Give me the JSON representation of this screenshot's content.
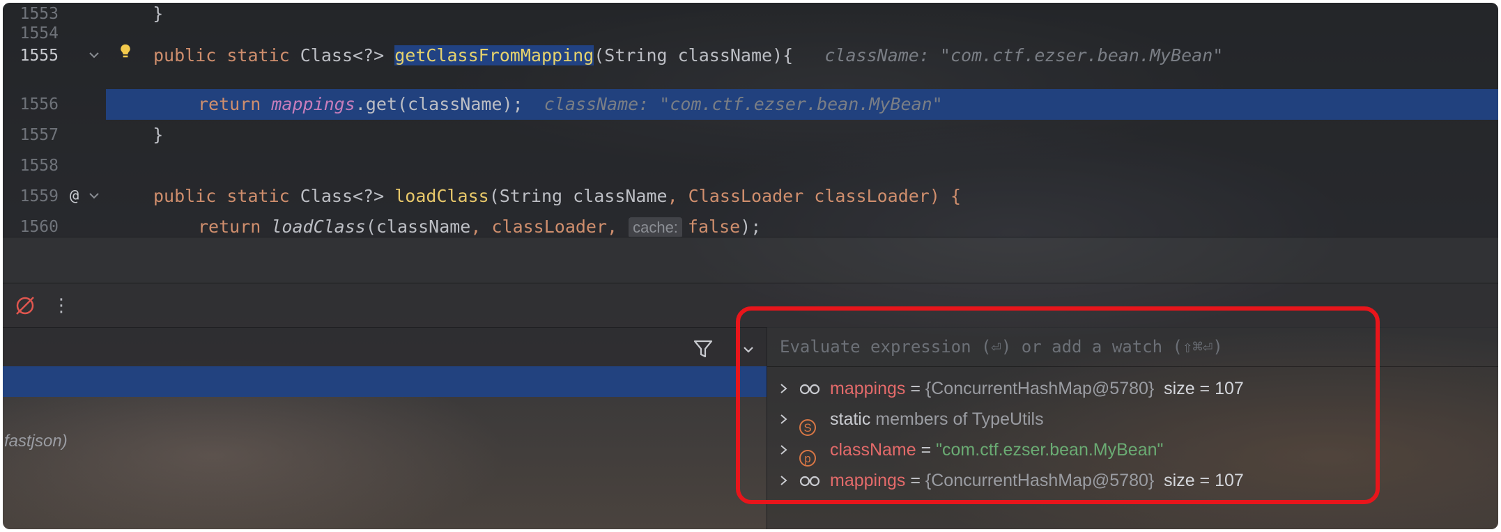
{
  "editor": {
    "lines": [
      {
        "num": "1553",
        "text": "    }"
      },
      {
        "num": "1554",
        "text": ""
      },
      {
        "num": "1555",
        "kw1": "public",
        "kw2": "static",
        "ret": "Class<?>",
        "method": "getClassFromMapping",
        "params": "(String className){",
        "hint": "className: \"com.ctf.ezser.bean.MyBean\""
      },
      {
        "num": "1556",
        "kw": "return",
        "field": "mappings",
        "call": ".get(className);",
        "hint": "className: \"com.ctf.ezser.bean.MyBean\""
      },
      {
        "num": "1557",
        "text": "    }"
      },
      {
        "num": "1558",
        "text": ""
      },
      {
        "num": "1559",
        "kw1": "public",
        "kw2": "static",
        "ret": "Class<?>",
        "method": "loadClass",
        "params_a": "(String className",
        "params_b": ", ClassLoader classLoader) {"
      },
      {
        "num": "1560",
        "kw": "return",
        "call": "loadClass",
        "args_a": "(className",
        "args_b": ", classLoader",
        "comma": ",",
        "inlay": "cache:",
        "literal": "false",
        "end": ");"
      }
    ]
  },
  "gutter": {
    "at_icon": "@",
    "bulb_icon": "lightbulb-icon",
    "fold_icon": "chevron-down-icon"
  },
  "debug_toolbar": {
    "mute_icon": "mute-breakpoints-icon",
    "more_icon": "⋮"
  },
  "frames": {
    "text": "fastjson)"
  },
  "variables": {
    "placeholder": "Evaluate expression (⏎) or add a watch (⇧⌘⏎)",
    "items": [
      {
        "icon": "watch-glasses-icon",
        "name": "mappings",
        "eq": " = ",
        "type": "{ConcurrentHashMap@5780}",
        "extra": "  size = 107"
      },
      {
        "icon": "static-icon",
        "icon_letter": "S",
        "name": "static",
        "rest": " members of TypeUtils"
      },
      {
        "icon": "parameter-icon",
        "icon_letter": "p",
        "name": "className",
        "eq": " = ",
        "value": "\"com.ctf.ezser.bean.MyBean\""
      },
      {
        "icon": "watch-glasses-icon",
        "name": "mappings",
        "eq": " = ",
        "type": "{ConcurrentHashMap@5780}",
        "extra": "  size = 107"
      }
    ]
  },
  "colors": {
    "accent": "#214283",
    "highlight": "#e8151b",
    "keyword": "#cf8e6d",
    "method": "#e8c86a",
    "string": "#6aab73",
    "var_name": "#e36a6a"
  }
}
